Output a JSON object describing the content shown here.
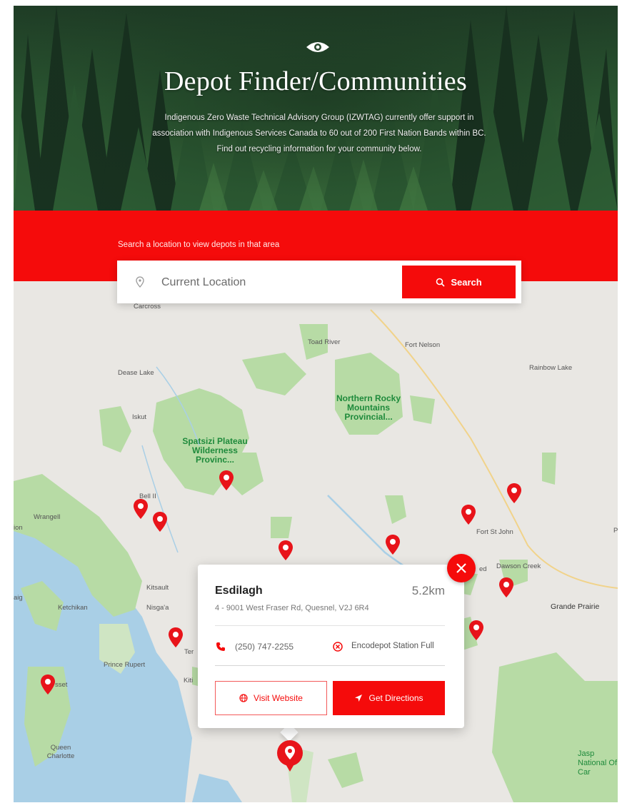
{
  "hero": {
    "title": "Depot Finder/Communities",
    "description": "Indigenous Zero Waste Technical Advisory Group (IZWTAG) currently offer support in association with Indigenous Services Canada to 60 out of 200 First Nation Bands within BC. Find out recycling information for your community below."
  },
  "search": {
    "label": "Search a location to view depots in that area",
    "placeholder": "Current Location",
    "button_label": "Search"
  },
  "map": {
    "places": {
      "carcross": "Carcross",
      "toad_river": "Toad River",
      "fort_nelson": "Fort Nelson",
      "rainbow_lake": "Rainbow Lake",
      "dease_lake": "Dease Lake",
      "iskut": "Iskut",
      "bell_ii": "Bell II",
      "wrangell": "Wrangell",
      "ion": "ion",
      "fort_st_john": "Fort St John",
      "dawson_creek": "Dawson Creek",
      "ed": "ed",
      "kitsault": "Kitsault",
      "nisgaa": "Nisga'a",
      "ketchikan": "Ketchikan",
      "aig": "aig",
      "grande_prairie": "Grande Prairie",
      "ter": "Ter",
      "prince_rupert": "Prince Rupert",
      "kiti": "Kiti",
      "masset": "sset",
      "queen_charlotte": "Queen Charlotte",
      "jasper": "Jasp National Of Car",
      "p": "P"
    },
    "parks": {
      "northern_rocky": "Northern Rocky Mountains Provincial...",
      "spatsizi": "Spatsizi Plateau Wilderness Provinc..."
    }
  },
  "popup": {
    "name": "Esdilagh",
    "distance": "5.2km",
    "address": "4 - 9001 West Fraser Rd, Quesnel, V2J 6R4",
    "phone": "(250) 747-2255",
    "status": "Encodepot Station Full",
    "visit_label": "Visit Website",
    "directions_label": "Get Directions"
  },
  "colors": {
    "accent": "#f50b0b",
    "park_green": "#b7dba5",
    "water": "#a9cfe6",
    "land": "#e9e7e3"
  }
}
